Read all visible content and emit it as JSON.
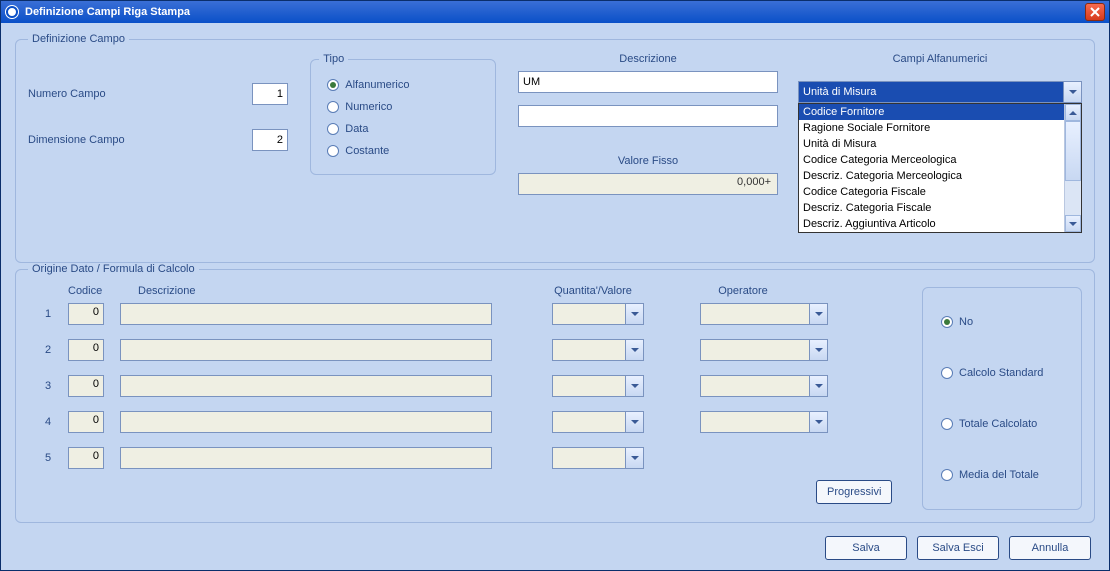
{
  "window": {
    "title": "Definizione Campi Riga Stampa"
  },
  "def_campo": {
    "legend": "Definizione Campo",
    "numero_label": "Numero Campo",
    "numero_value": "1",
    "dimensione_label": "Dimensione Campo",
    "dimensione_value": "2",
    "tipo": {
      "legend": "Tipo",
      "options": [
        {
          "label": "Alfanumerico",
          "selected": true
        },
        {
          "label": "Numerico",
          "selected": false
        },
        {
          "label": "Data",
          "selected": false
        },
        {
          "label": "Costante",
          "selected": false
        }
      ]
    },
    "descrizione_label": "Descrizione",
    "descrizione_value": "UM",
    "descrizione2_value": "",
    "valore_fisso_label": "Valore Fisso",
    "valore_fisso_value": "0,000+",
    "campi_alpha": {
      "label": "Campi Alfanumerici",
      "selected": "Unità di Misura",
      "options": [
        {
          "label": "Codice Fornitore",
          "highlighted": true
        },
        {
          "label": "Ragione Sociale Fornitore",
          "highlighted": false
        },
        {
          "label": "Unità di Misura",
          "highlighted": false
        },
        {
          "label": "Codice Categoria Merceologica",
          "highlighted": false
        },
        {
          "label": "Descriz. Categoria Merceologica",
          "highlighted": false
        },
        {
          "label": "Codice Categoria Fiscale",
          "highlighted": false
        },
        {
          "label": "Descriz. Categoria Fiscale",
          "highlighted": false
        },
        {
          "label": "Descriz. Aggiuntiva Articolo",
          "highlighted": false
        }
      ]
    }
  },
  "origine": {
    "legend": "Origine Dato / Formula di Calcolo",
    "headers": {
      "codice": "Codice",
      "descrizione": "Descrizione",
      "qv": "Quantita'/Valore",
      "operatore": "Operatore"
    },
    "rows": [
      {
        "idx": "1",
        "codice": "0"
      },
      {
        "idx": "2",
        "codice": "0"
      },
      {
        "idx": "3",
        "codice": "0"
      },
      {
        "idx": "4",
        "codice": "0"
      },
      {
        "idx": "5",
        "codice": "0"
      }
    ],
    "progressivi_label": "Progressivi",
    "calc_mode": {
      "options": [
        {
          "label": "No",
          "selected": true
        },
        {
          "label": "Calcolo Standard",
          "selected": false
        },
        {
          "label": "Totale Calcolato",
          "selected": false
        },
        {
          "label": "Media del Totale",
          "selected": false
        }
      ]
    }
  },
  "buttons": {
    "salva": "Salva",
    "salva_esci": "Salva Esci",
    "annulla": "Annulla"
  }
}
